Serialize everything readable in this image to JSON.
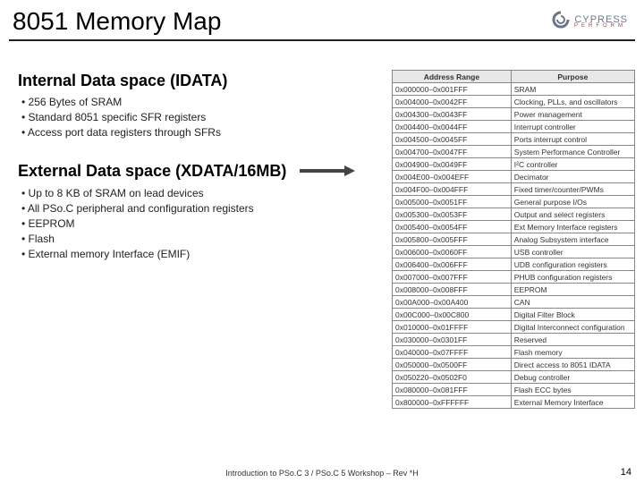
{
  "title": "8051 Memory Map",
  "logo_text": "CYPRESS",
  "logo_sub": "PERFORM",
  "section1": {
    "heading": "Internal Data space (IDATA)",
    "items": [
      "256 Bytes of SRAM",
      "Standard 8051 specific SFR registers",
      "Access port data registers through SFRs"
    ]
  },
  "section2": {
    "heading": "External Data space (XDATA/16MB)",
    "items": [
      "Up to 8 KB of SRAM on lead devices",
      "All PSo.C peripheral and configuration registers",
      "EEPROM",
      "Flash",
      "External memory Interface (EMIF)"
    ]
  },
  "table": {
    "headers": [
      "Address Range",
      "Purpose"
    ],
    "rows": [
      [
        "0x000000–0x001FFF",
        "SRAM"
      ],
      [
        "0x004000–0x0042FF",
        "Clocking, PLLs, and oscillators"
      ],
      [
        "0x004300–0x0043FF",
        "Power management"
      ],
      [
        "0x004400–0x0044FF",
        "Interrupt controller"
      ],
      [
        "0x004500–0x0045FF",
        "Ports interrupt control"
      ],
      [
        "0x004700–0x0047FF",
        "System Performance Controller"
      ],
      [
        "0x004900–0x0049FF",
        "I²C controller"
      ],
      [
        "0x004E00–0x004EFF",
        "Decimator"
      ],
      [
        "0x004F00–0x004FFF",
        "Fixed timer/counter/PWMs"
      ],
      [
        "0x005000–0x0051FF",
        "General purpose I/Os"
      ],
      [
        "0x005300–0x0053FF",
        "Output and select registers"
      ],
      [
        "0x005400–0x0054FF",
        "Ext Memory Interface registers"
      ],
      [
        "0x005800–0x005FFF",
        "Analog Subsystem interface"
      ],
      [
        "0x006000–0x0060FF",
        "USB controller"
      ],
      [
        "0x006400–0x006FFF",
        "UDB configuration registers"
      ],
      [
        "0x007000–0x007FFF",
        "PHUB configuration registers"
      ],
      [
        "0x008000–0x008FFF",
        "EEPROM"
      ],
      [
        "0x00A000–0x00A400",
        "CAN"
      ],
      [
        "0x00C000–0x00C800",
        "Digital Filter Block"
      ],
      [
        "0x010000–0x01FFFF",
        "Digital Interconnect configuration"
      ],
      [
        "0x030000–0x0301FF",
        "Reserved"
      ],
      [
        "0x040000–0x07FFFF",
        "Flash memory"
      ],
      [
        "0x050000–0x0500FF",
        "Direct access to 8051 IDATA"
      ],
      [
        "0x050220–0x0502F0",
        "Debug controller"
      ],
      [
        "0x080000–0x081FFF",
        "Flash ECC bytes"
      ],
      [
        "0x800000–0xFFFFFF",
        "External Memory Interface"
      ]
    ]
  },
  "footer": "Introduction to PSo.C 3 / PSo.C 5 Workshop – Rev *H",
  "page": "14"
}
